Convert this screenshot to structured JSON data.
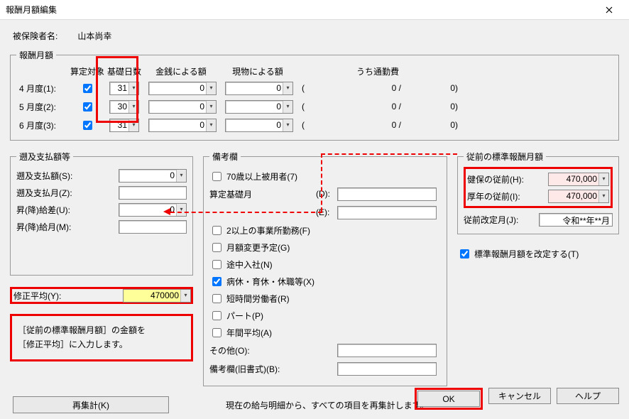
{
  "window": {
    "title": "報酬月額編集"
  },
  "insured": {
    "label": "被保険者名:",
    "name": "山本尚幸"
  },
  "monthly": {
    "legend": "報酬月額",
    "headers": {
      "target": "算定対象",
      "days": "基礎日数",
      "cash": "金銭による額",
      "goods": "現物による額",
      "commute": "うち通勤費"
    },
    "rows": [
      {
        "label": "4 月度(1):",
        "checked": true,
        "days": "31",
        "cash": "0",
        "goods": "0",
        "commute_a": "0 /",
        "commute_b": "0)"
      },
      {
        "label": "5 月度(2):",
        "checked": true,
        "days": "30",
        "cash": "0",
        "goods": "0",
        "commute_a": "0 /",
        "commute_b": "0)"
      },
      {
        "label": "6 月度(3):",
        "checked": true,
        "days": "31",
        "cash": "0",
        "goods": "0",
        "commute_a": "0 /",
        "commute_b": "0)"
      }
    ]
  },
  "retro": {
    "legend": "遡及支払額等",
    "amount": {
      "label": "遡及支払額(S):",
      "value": "0"
    },
    "month": {
      "label": "遡及支払月(Z):"
    },
    "raise_amt": {
      "label": "昇(降)給差(U):",
      "value": "0"
    },
    "raise_month": {
      "label": "昇(降)給月(M):"
    },
    "corrected": {
      "label": "修正平均(Y):",
      "value": "470000"
    }
  },
  "callout": {
    "line1": "［従前の標準報酬月額］の金額を",
    "line2": "［修正平均］に入力します。"
  },
  "remarks": {
    "legend": "備考欄",
    "over70": "70歳以上被用者(7)",
    "base_month_label": "算定基礎月",
    "key_d": "(D):",
    "key_e": "(E):",
    "multi_office": "2以上の事業所勤務(F)",
    "month_change": "月額変更予定(G)",
    "midyear": "途中入社(N)",
    "leave": "病休・育休・休職等(X)",
    "leave_checked": true,
    "shorttime": "短時間労働者(R)",
    "part": "パート(P)",
    "annual": "年間平均(A)",
    "other_label": "その他(O):",
    "old_label": "備考欄(旧書式)(B):"
  },
  "prev": {
    "legend": "従前の標準報酬月額",
    "kenpo": {
      "label": "健保の従前(H):",
      "value": "470,000"
    },
    "kounen": {
      "label": "厚年の従前(I):",
      "value": "470,000"
    },
    "revise_month": {
      "label": "従前改定月(J):",
      "value": "令和**年**月"
    },
    "revise_std": "標準報酬月額を改定する(T)",
    "revise_checked": true
  },
  "recalc": {
    "button": "再集計(K)",
    "message": "現在の給与明細から、すべての項目を再集計します。"
  },
  "buttons": {
    "ok": "OK",
    "cancel": "キャンセル",
    "help": "ヘルプ"
  }
}
